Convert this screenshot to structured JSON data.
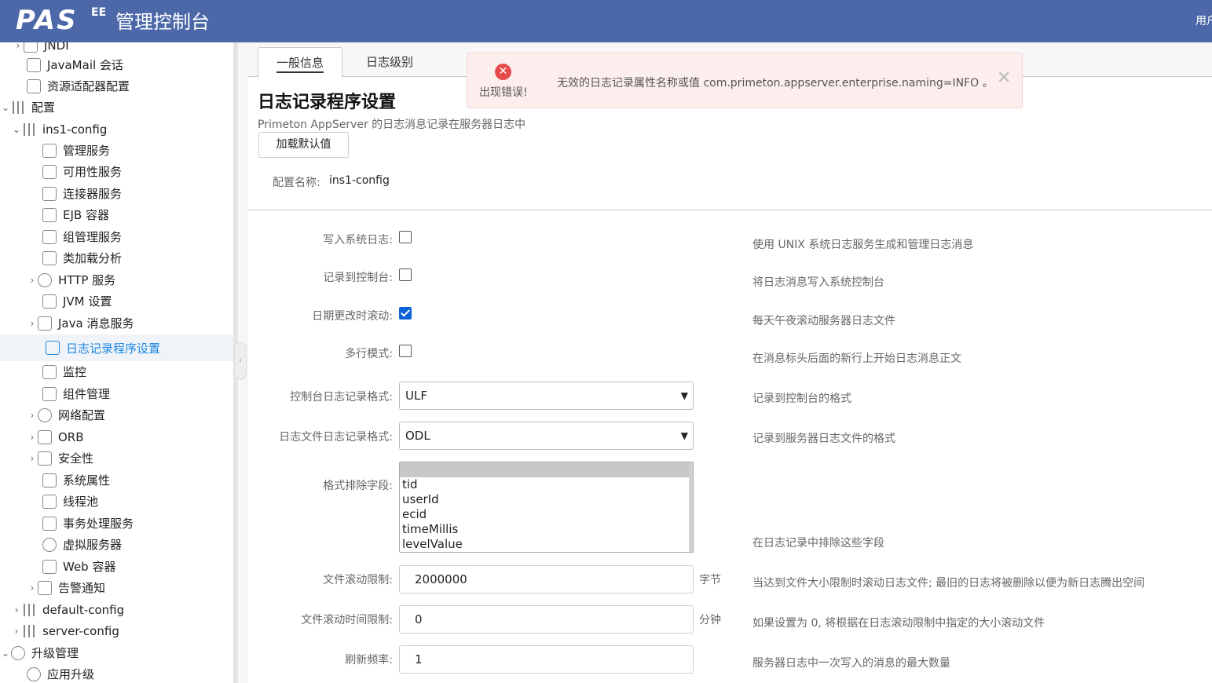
{
  "header": {
    "logo": "PAS",
    "edition": "EE",
    "title": "管理控制台",
    "user": "用户"
  },
  "sidebar": {
    "items": [
      {
        "label": "JNDI",
        "icon": "folder-icon"
      },
      {
        "label": "JavaMail 会话",
        "icon": "mail-icon"
      },
      {
        "label": "资源适配器配置",
        "icon": "home-icon"
      },
      {
        "label": "配置",
        "icon": "config-icon"
      },
      {
        "label": "ins1-config",
        "icon": "config-icon"
      },
      {
        "label": "管理服务",
        "icon": "home-icon"
      },
      {
        "label": "可用性服务",
        "icon": "server-icon"
      },
      {
        "label": "连接器服务",
        "icon": "home-icon"
      },
      {
        "label": "EJB 容器",
        "icon": "cube-icon"
      },
      {
        "label": "组管理服务",
        "icon": "gear-icon"
      },
      {
        "label": "类加载分析",
        "icon": "cube-icon"
      },
      {
        "label": "HTTP 服务",
        "icon": "http-icon"
      },
      {
        "label": "JVM 设置",
        "icon": "java-icon"
      },
      {
        "label": "Java 消息服务",
        "icon": "mail-icon"
      },
      {
        "label": "日志记录程序设置",
        "icon": "edit-icon"
      },
      {
        "label": "监控",
        "icon": "chart-icon"
      },
      {
        "label": "组件管理",
        "icon": "cube-icon"
      },
      {
        "label": "网络配置",
        "icon": "http-icon"
      },
      {
        "label": "ORB",
        "icon": "orb-icon"
      },
      {
        "label": "安全性",
        "icon": "shield-icon"
      },
      {
        "label": "系统属性",
        "icon": "gear-icon"
      },
      {
        "label": "线程池",
        "icon": "pool-icon"
      },
      {
        "label": "事务处理服务",
        "icon": "transaction-icon"
      },
      {
        "label": "虚拟服务器",
        "icon": "http-icon"
      },
      {
        "label": "Web 容器",
        "icon": "cube-icon"
      },
      {
        "label": "告警通知",
        "icon": "chart-icon"
      },
      {
        "label": "default-config",
        "icon": "config-icon"
      },
      {
        "label": "server-config",
        "icon": "config-icon"
      },
      {
        "label": "升级管理",
        "icon": "globe-icon"
      },
      {
        "label": "应用升级",
        "icon": "globe-icon"
      }
    ]
  },
  "tabs": [
    {
      "label": "一般信息"
    },
    {
      "label": "日志级别"
    }
  ],
  "alert": {
    "title": "出现错误!",
    "message": "无效的日志记录属性名称或值 com.primeton.appserver.enterprise.naming=INFO 。",
    "close": "✕",
    "icon": "error-icon"
  },
  "page": {
    "title": "日志记录程序设置",
    "subtitle": "Primeton AppServer 的日志消息记录在服务器日志中",
    "load_defaults": "加载默认值",
    "config_name_label": "配置名称:",
    "config_name_value": "ins1-config"
  },
  "form": {
    "write_syslog": {
      "label": "写入系统日志:",
      "checked": false,
      "desc": "使用 UNIX 系统日志服务生成和管理日志消息"
    },
    "log_console": {
      "label": "记录到控制台:",
      "checked": false,
      "desc": "将日志消息写入系统控制台"
    },
    "rotate_date": {
      "label": "日期更改时滚动:",
      "checked": true,
      "desc": "每天午夜滚动服务器日志文件"
    },
    "multiline": {
      "label": "多行模式:",
      "checked": false,
      "desc": "在消息标头后面的新行上开始日志消息正文"
    },
    "console_format": {
      "label": "控制台日志记录格式:",
      "value": "ULF",
      "desc": "记录到控制台的格式"
    },
    "file_format": {
      "label": "日志文件日志记录格式:",
      "value": "ODL",
      "desc": "记录到服务器日志文件的格式"
    },
    "exclude_fields": {
      "label": "格式排除字段:",
      "options": [
        "tid",
        "userId",
        "ecid",
        "timeMillis",
        "levelValue"
      ],
      "desc": "在日志记录中排除这些字段"
    },
    "file_rotation_limit": {
      "label": "文件滚动限制:",
      "value": "2000000",
      "unit": "字节",
      "desc": "当达到文件大小限制时滚动日志文件; 最旧的日志将被删除以便为新日志腾出空间"
    },
    "file_rotation_time": {
      "label": "文件滚动时间限制:",
      "value": "0",
      "unit": "分钟",
      "desc": "如果设置为 0, 将根据在日志滚动限制中指定的大小滚动文件"
    },
    "flush_frequency": {
      "label": "刷新频率:",
      "value": "1",
      "desc": "服务器日志中一次写入的消息的最大数量"
    }
  }
}
